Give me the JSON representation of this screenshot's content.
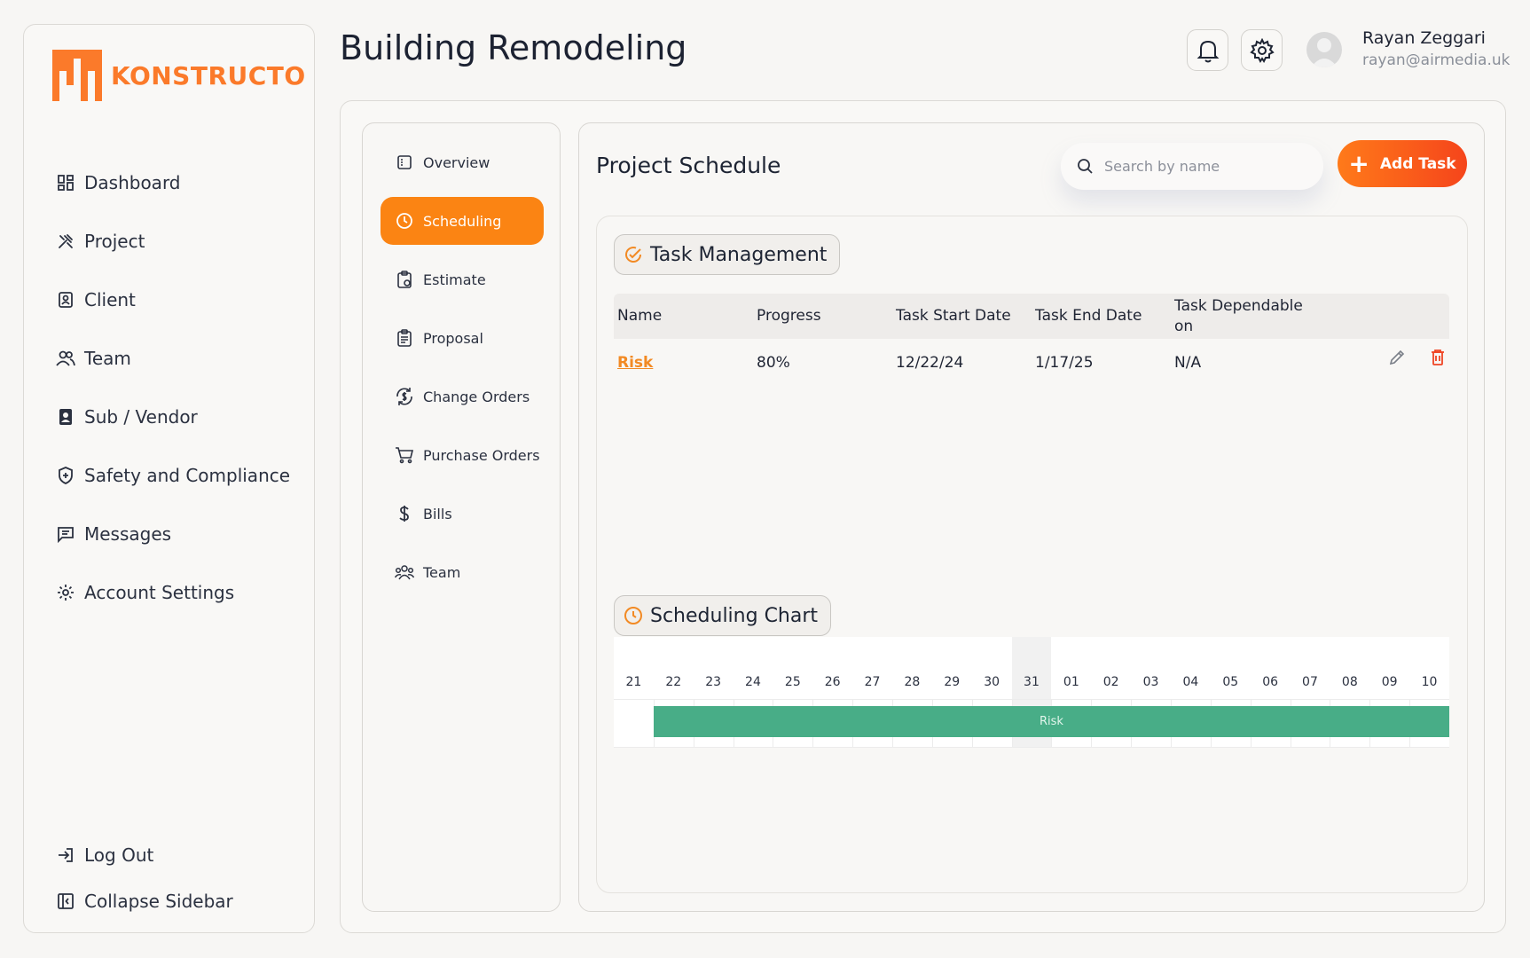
{
  "brand": {
    "name": "KONSTRUCTO",
    "accent": "#fb7a2a"
  },
  "sidebar": {
    "items": [
      {
        "label": "Dashboard",
        "icon": "dashboard-icon"
      },
      {
        "label": "Project",
        "icon": "tools-icon"
      },
      {
        "label": "Client",
        "icon": "client-icon"
      },
      {
        "label": "Team",
        "icon": "team-icon"
      },
      {
        "label": "Sub / Vendor",
        "icon": "vendor-icon"
      },
      {
        "label": "Safety and Compliance",
        "icon": "shield-icon"
      },
      {
        "label": "Messages",
        "icon": "message-icon"
      },
      {
        "label": "Account Settings",
        "icon": "gear-icon"
      }
    ],
    "logout_label": "Log Out",
    "collapse_label": "Collapse Sidebar"
  },
  "header": {
    "title": "Building Remodeling",
    "user": {
      "name": "Rayan Zeggari",
      "email": "rayan@airmedia.uk"
    }
  },
  "subnav": {
    "items": [
      {
        "label": "Overview",
        "icon": "overview-icon"
      },
      {
        "label": "Scheduling",
        "icon": "clock-icon",
        "active": true
      },
      {
        "label": "Estimate",
        "icon": "clipboard-icon"
      },
      {
        "label": "Proposal",
        "icon": "document-icon"
      },
      {
        "label": "Change Orders",
        "icon": "refresh-dollar-icon"
      },
      {
        "label": "Purchase Orders",
        "icon": "cart-icon"
      },
      {
        "label": "Bills",
        "icon": "dollar-icon"
      },
      {
        "label": "Team",
        "icon": "team-icon"
      }
    ]
  },
  "content": {
    "title": "Project Schedule",
    "search_placeholder": "Search by name",
    "add_task_label": "Add Task"
  },
  "task_management": {
    "title": "Task Management",
    "columns": [
      "Name",
      "Progress",
      "Task Start Date",
      "Task End Date",
      "Task Dependable on"
    ],
    "rows": [
      {
        "name": "Risk",
        "progress": "80%",
        "start": "12/22/24",
        "end": "1/17/25",
        "depends_on": "N/A"
      }
    ]
  },
  "scheduling_chart": {
    "title": "Scheduling Chart",
    "days": [
      "21",
      "22",
      "23",
      "24",
      "25",
      "26",
      "27",
      "28",
      "29",
      "30",
      "31",
      "01",
      "02",
      "03",
      "04",
      "05",
      "06",
      "07",
      "08",
      "09",
      "10"
    ],
    "highlight_day": "31",
    "bars": [
      {
        "label": "Risk",
        "start_day": "22",
        "end_day": "10",
        "color": "#48ad87"
      }
    ]
  }
}
